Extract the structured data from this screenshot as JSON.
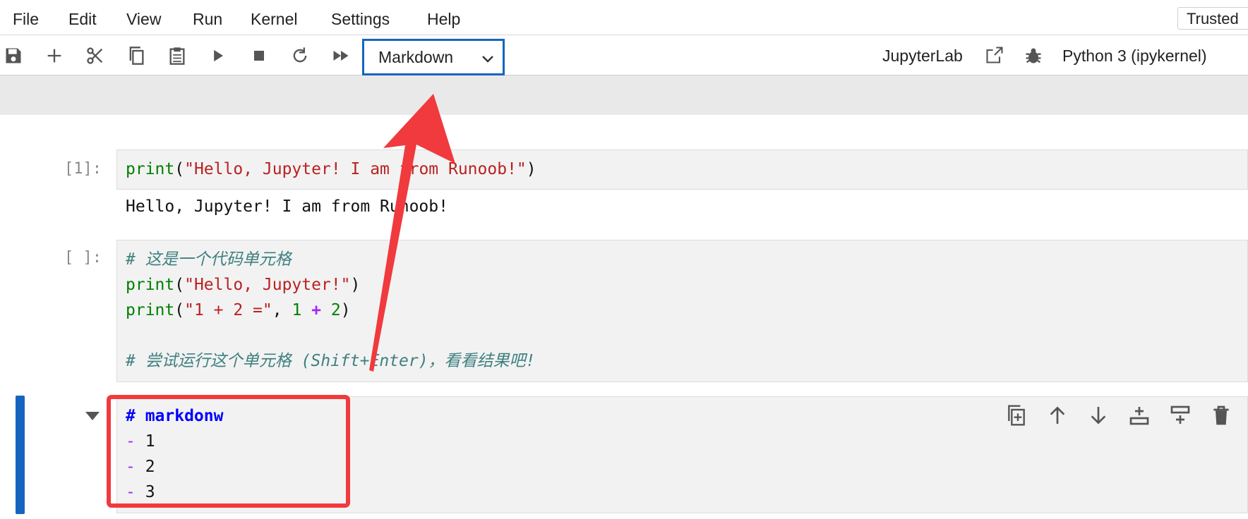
{
  "menubar": {
    "items": [
      "File",
      "Edit",
      "View",
      "Run",
      "Kernel",
      "Settings",
      "Help"
    ],
    "trusted_label": "Trusted"
  },
  "toolbar": {
    "icons": [
      "save-icon",
      "add-cell-icon",
      "cut-icon",
      "copy-icon",
      "paste-icon",
      "run-icon",
      "stop-icon",
      "restart-icon",
      "fast-forward-icon"
    ],
    "cell_type": "Markdown",
    "jupyterlab_label": "JupyterLab",
    "kernel_name": "Python 3 (ipykernel)"
  },
  "cells": [
    {
      "prompt": "[1]:",
      "code": {
        "fn": "print",
        "open": "(",
        "str": "\"Hello, Jupyter! I am from Runoob!\"",
        "close": ")"
      },
      "output": "Hello, Jupyter! I am from Runoob!"
    },
    {
      "prompt": "[ ]:",
      "comment1": "# 这是一个代码单元格",
      "line2": {
        "fn": "print",
        "open": "(",
        "str": "\"Hello, Jupyter!\"",
        "close": ")"
      },
      "line3": {
        "fn": "print",
        "open": "(",
        "str": "\"1 + 2 =\"",
        "comma": ", ",
        "n1": "1",
        "plus": "+",
        "n2": "2",
        "close": ")"
      },
      "comment2": "# 尝试运行这个单元格 (Shift+Enter)，看看结果吧!"
    },
    {
      "heading": "# markdonw",
      "bullets": [
        {
          "dash": "-",
          "text": "1"
        },
        {
          "dash": "-",
          "text": "2"
        },
        {
          "dash": "-",
          "text": "3"
        }
      ]
    }
  ],
  "cell_actions": [
    "duplicate-icon",
    "move-up-icon",
    "move-down-icon",
    "insert-above-icon",
    "insert-below-icon",
    "delete-icon"
  ],
  "colors": {
    "accent": "#1565c0",
    "annotation": "#f03a3e"
  }
}
